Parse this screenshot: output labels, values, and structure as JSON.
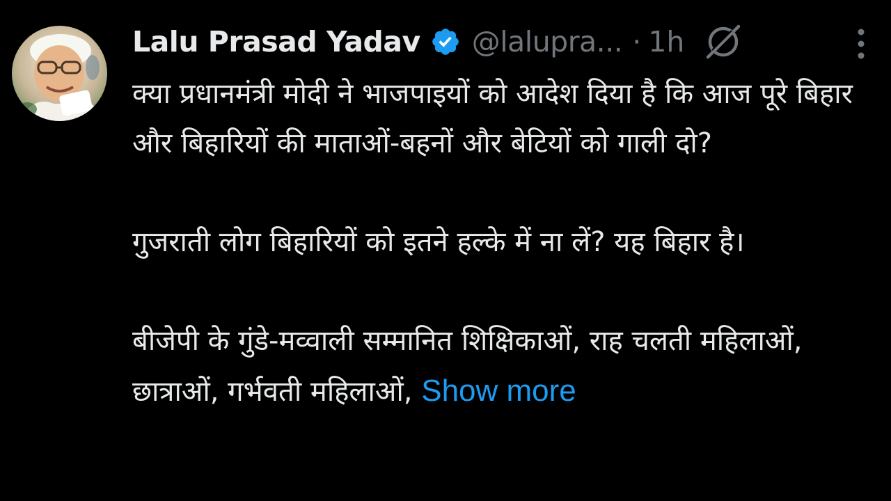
{
  "tweet": {
    "display_name": "Lalu Prasad Yadav",
    "handle": "@lalupra...",
    "separator": "·",
    "time": "1h",
    "icons": {
      "verified": "verified-badge-icon",
      "grok": "grok-icon",
      "more": "more-vertical-icon",
      "avatar": "profile-photo"
    },
    "colors": {
      "background": "#000000",
      "text": "#e7e9ea",
      "muted": "#71767b",
      "link": "#1d9bf0",
      "verified": "#1d9bf0"
    },
    "paragraphs": [
      "क्या प्रधानमंत्री मोदी ने भाजपाइयों को आदेश दिया है कि आज पूरे बिहार और बिहारियों की माताओं-बहनों और बेटियों को गाली दो?",
      "गुजराती लोग बिहारियों को इतने हल्के में ना लें? यह बिहार है।"
    ],
    "last_paragraph": "बीजेपी के गुंडे-मव्वाली सम्मानित शिक्षिकाओं, राह चलती महिलाओं, छात्राओं, गर्भवती महिलाओं,",
    "show_more_label": "Show more"
  }
}
